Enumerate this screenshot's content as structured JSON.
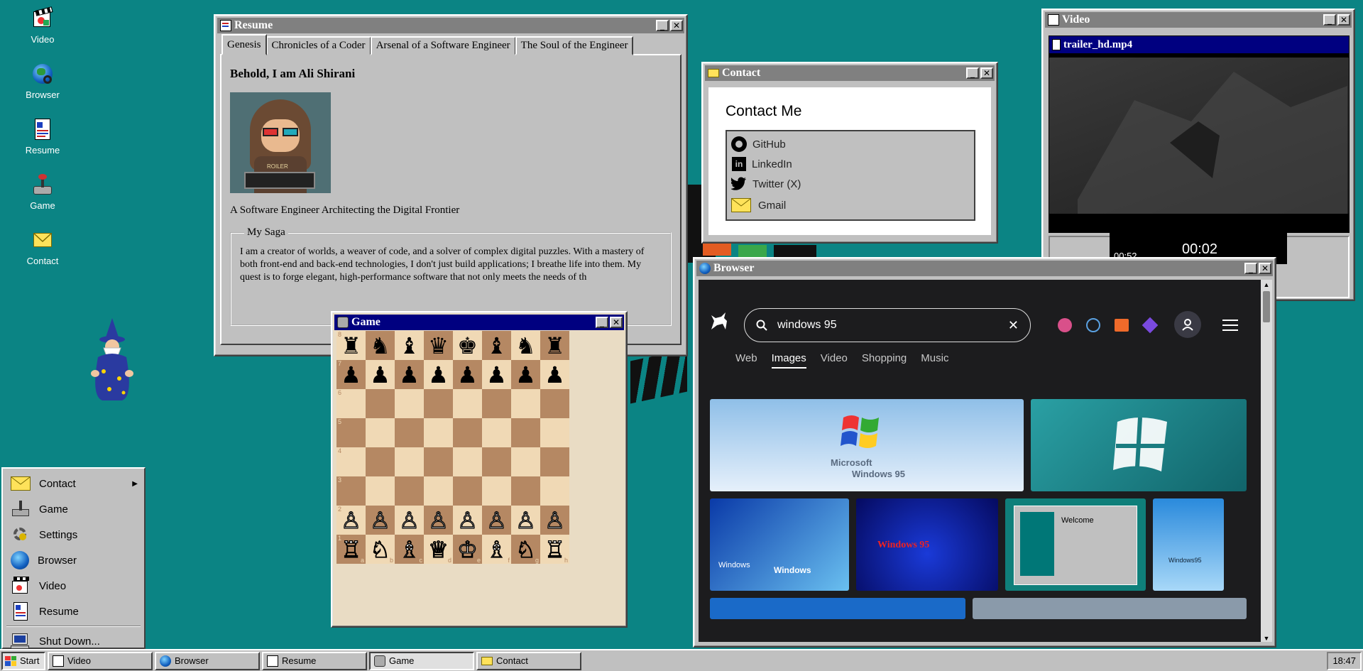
{
  "desktop_icons": [
    {
      "label": "Video"
    },
    {
      "label": "Browser"
    },
    {
      "label": "Resume"
    },
    {
      "label": "Game"
    },
    {
      "label": "Contact"
    }
  ],
  "resume": {
    "title": "Resume",
    "tabs": [
      "Genesis",
      "Chronicles of a Coder",
      "Arsenal of a Software Engineer",
      "The Soul of the Engineer"
    ],
    "heading": "Behold, I am Ali Shirani",
    "avatar_text": "ROILER",
    "tagline": "A Software Engineer Architecting the Digital Frontier",
    "saga_legend": "My Saga",
    "saga_text": "I am a creator of worlds, a weaver of code, and a solver of complex digital puzzles. With a mastery of both front-end and back-end technologies, I don't just build applications; I breathe life into them. My quest is to forge elegant, high-performance software that not only meets the needs of th"
  },
  "contact": {
    "title": "Contact",
    "heading": "Contact Me",
    "links": [
      "GitHub",
      "LinkedIn",
      "Twitter (X)",
      "Gmail"
    ]
  },
  "video": {
    "title": "Video",
    "filename": "trailer_hd.mp4",
    "duration": "00:52",
    "current": "00:02"
  },
  "game": {
    "title": "Game",
    "ranks": [
      "8",
      "7",
      "6",
      "5",
      "4",
      "3",
      "2",
      "1"
    ],
    "files": [
      "a",
      "b",
      "c",
      "d",
      "e",
      "f",
      "g",
      "h"
    ],
    "board": [
      [
        "♜",
        "♞",
        "♝",
        "♛",
        "♚",
        "♝",
        "♞",
        "♜"
      ],
      [
        "♟",
        "♟",
        "♟",
        "♟",
        "♟",
        "♟",
        "♟",
        "♟"
      ],
      [
        "",
        "",
        "",
        "",
        "",
        "",
        "",
        ""
      ],
      [
        "",
        "",
        "",
        "",
        "",
        "",
        "",
        ""
      ],
      [
        "",
        "",
        "",
        "",
        "",
        "",
        "",
        ""
      ],
      [
        "",
        "",
        "",
        "",
        "",
        "",
        "",
        ""
      ],
      [
        "♙",
        "♙",
        "♙",
        "♙",
        "♙",
        "♙",
        "♙",
        "♙"
      ],
      [
        "♖",
        "♘",
        "♗",
        "♕",
        "♔",
        "♗",
        "♘",
        "♖"
      ]
    ]
  },
  "browser": {
    "title": "Browser",
    "query": "windows 95",
    "tabs": [
      "Web",
      "Images",
      "Video",
      "Shopping",
      "Music"
    ],
    "selected_tab": "Images",
    "thumb_texts": [
      "Microsoft",
      "Windows 95",
      "Windows",
      "Windows",
      "Windows 95",
      "Welcome",
      "Windows95"
    ]
  },
  "start_menu": {
    "items": [
      "Contact",
      "Game",
      "Settings",
      "Browser",
      "Video",
      "Resume"
    ],
    "shutdown": "Shut Down..."
  },
  "taskbar": {
    "start": "Start",
    "items": [
      "Video",
      "Browser",
      "Resume",
      "Game",
      "Contact"
    ],
    "active": "Game",
    "clock": "18:47"
  },
  "colors": {
    "desktop": "#0b8484",
    "title_active": "#000080",
    "title_inactive": "#808080",
    "face": "#c0c0c0"
  }
}
